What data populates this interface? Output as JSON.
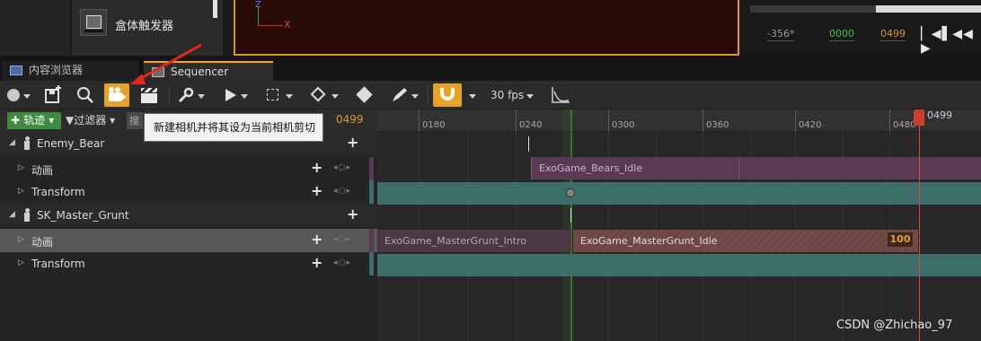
{
  "top": {
    "actor_label": "盒体触发器",
    "axis_x_label": "X",
    "axis_z_label": "Z",
    "timecodes": {
      "start": "-356*",
      "current": "0000",
      "end": "0499"
    },
    "transport_glyphs": "▏◀▌◀◀ ▶"
  },
  "tabs": [
    {
      "label": "内容浏览器",
      "active": false
    },
    {
      "label": "Sequencer",
      "active": true
    }
  ],
  "toolbar": {
    "fps_label": "30 fps",
    "camera_highlight": "#e8a226",
    "snap_highlight": "#e8a226"
  },
  "tooltip": {
    "text": "新建相机并将其设为当前相机剪切"
  },
  "filterbar": {
    "track_label": "轨迹",
    "filter_label": "过滤器",
    "search_stub": "搜",
    "frame_value": "0499"
  },
  "outliner": {
    "rows": [
      {
        "label": "Enemy_Bear",
        "kind": "actor"
      },
      {
        "label": "动画",
        "kind": "track"
      },
      {
        "label": "Transform",
        "kind": "track"
      },
      {
        "label": "SK_Master_Grunt",
        "kind": "actor"
      },
      {
        "label": "动画",
        "kind": "track",
        "selected": true
      },
      {
        "label": "Transform",
        "kind": "track"
      }
    ],
    "key_glyphs": "◂○▸"
  },
  "timeline": {
    "ticks": [
      "0180",
      "0240",
      "0300",
      "0360",
      "0420",
      "0480"
    ],
    "playhead_label": "0499",
    "sections": {
      "bear_idle": "ExoGame_Bears_Idle",
      "grunt_intro": "ExoGame_MasterGrunt_Intro",
      "grunt_idle": "ExoGame_MasterGrunt_Idle"
    },
    "weight_badge": "100"
  },
  "watermark": "CSDN @Zhichao_97"
}
